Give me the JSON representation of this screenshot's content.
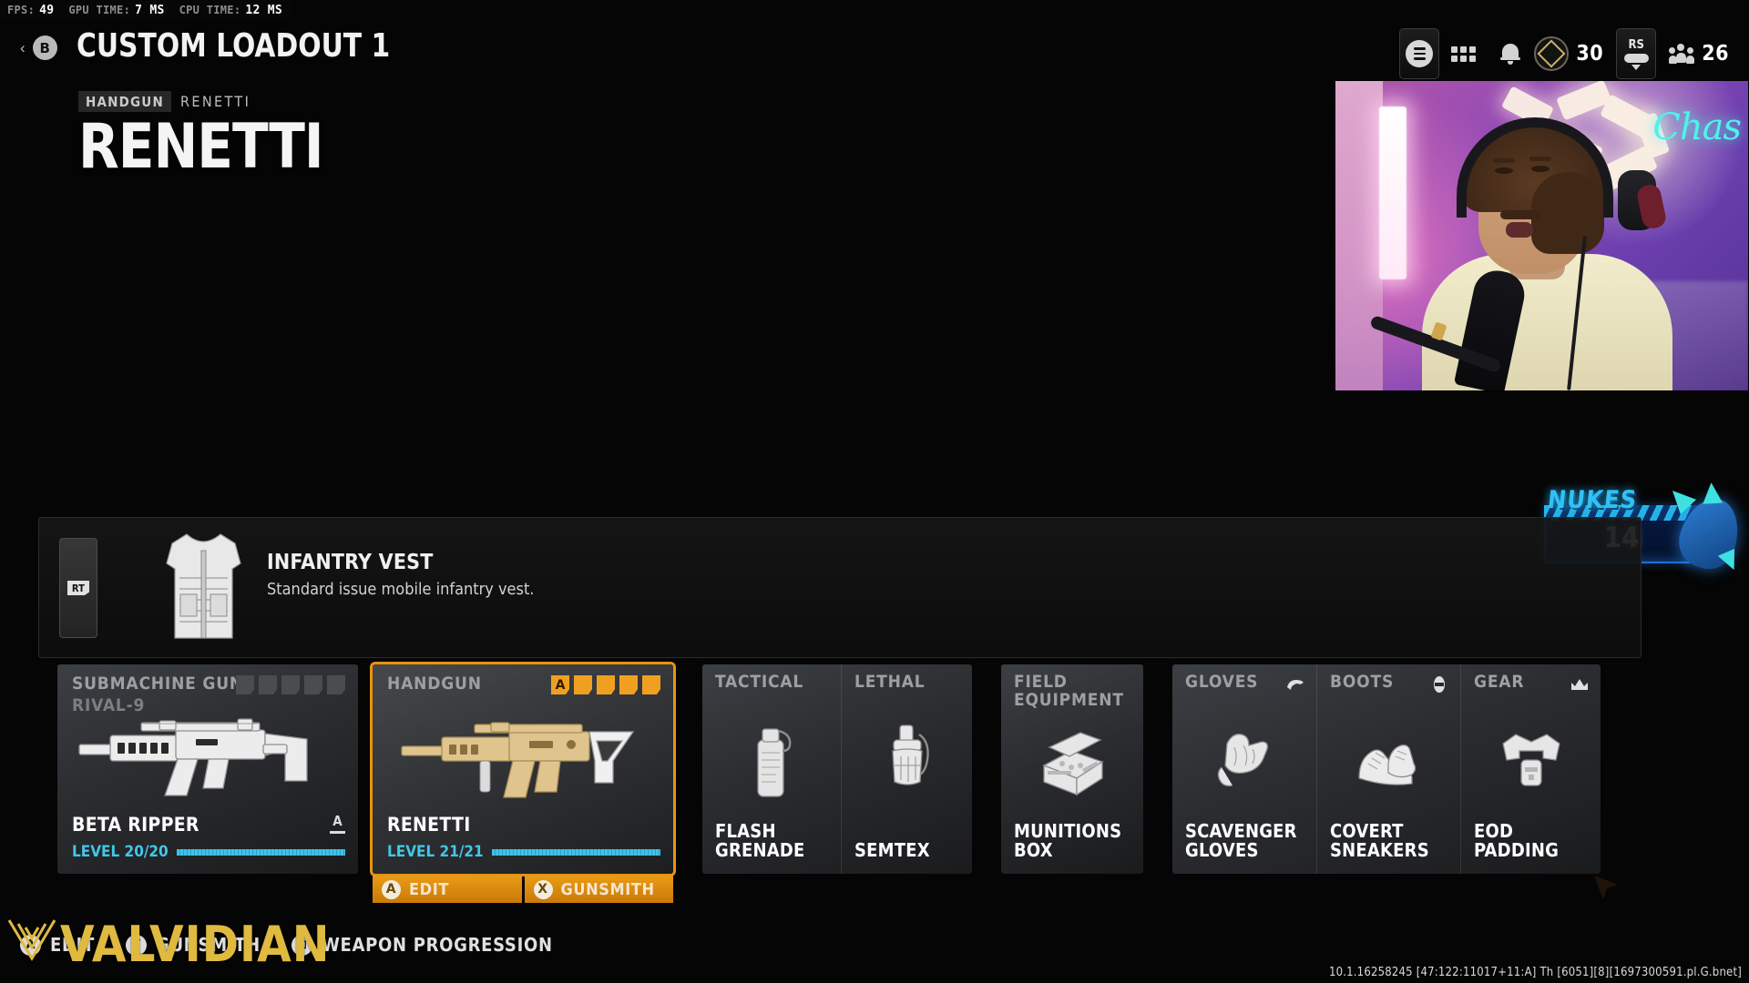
{
  "perf": {
    "stats": [
      {
        "key": "FPS:",
        "value": "49"
      },
      {
        "key": "GPU TIME:",
        "value": "7 MS"
      },
      {
        "key": "CPU TIME:",
        "value": "12 MS"
      }
    ]
  },
  "header": {
    "back_glyph": "B",
    "back_chevron": "‹",
    "title": "CUSTOM LOADOUT 1"
  },
  "hud": {
    "menu_icon": "hamburger-pill-icon",
    "apps_icon": "grid-icon",
    "bell_icon": "bell-icon",
    "rank_icon": "rank-badge-icon",
    "rank_value": "30",
    "rs_label": "RS",
    "party_icon": "party-icon",
    "party_value": "26"
  },
  "weapon": {
    "category_chip": "HANDGUN",
    "category_name": "RENETTI",
    "display_name": "RENETTI"
  },
  "nukes": {
    "title": "NUKES",
    "count": "14",
    "accent": "#2fc2f7"
  },
  "vest": {
    "trigger_glyph": "RT",
    "icon": "tactical-vest-icon",
    "title": "INFANTRY VEST",
    "description": "Standard issue mobile infantry vest."
  },
  "loadout": {
    "primary": {
      "category": "SUBMACHINE GUN",
      "subtitle": "RIVAL-9",
      "name": "BETA RIPPER",
      "level": "LEVEL 20/20",
      "level_percent": 100,
      "pips": [
        {
          "state": "off",
          "label": ""
        },
        {
          "state": "off",
          "label": ""
        },
        {
          "state": "off",
          "label": ""
        },
        {
          "state": "off",
          "label": ""
        },
        {
          "state": "off",
          "label": ""
        }
      ],
      "rank_glyph": "A",
      "selected": false
    },
    "secondary": {
      "category": "HANDGUN",
      "subtitle": "",
      "name": "RENETTI",
      "level": "LEVEL 21/21",
      "level_percent": 100,
      "pips": [
        {
          "state": "badge",
          "label": "A"
        },
        {
          "state": "on",
          "label": ""
        },
        {
          "state": "on",
          "label": ""
        },
        {
          "state": "on",
          "label": ""
        },
        {
          "state": "on",
          "label": ""
        }
      ],
      "selected": true,
      "actions": [
        {
          "glyph": "A",
          "label": "EDIT"
        },
        {
          "glyph": "X",
          "label": "GUNSMITH"
        }
      ]
    },
    "equipment": [
      {
        "category": "TACTICAL",
        "label": "FLASH GRENADE",
        "icon": "flash-grenade-icon",
        "perk_icon": ""
      },
      {
        "category": "LETHAL",
        "label": "SEMTEX",
        "icon": "semtex-grenade-icon",
        "perk_icon": ""
      }
    ],
    "field": [
      {
        "category": "FIELD EQUIPMENT",
        "label": "MUNITIONS BOX",
        "icon": "munitions-box-icon",
        "perk_icon": ""
      }
    ],
    "perks": [
      {
        "category": "GLOVES",
        "label": "SCAVENGER GLOVES",
        "icon": "gloves-icon",
        "perk_icon": "perk-glove-icon"
      },
      {
        "category": "BOOTS",
        "label": "COVERT SNEAKERS",
        "icon": "sneakers-icon",
        "perk_icon": "perk-boot-icon"
      },
      {
        "category": "GEAR",
        "label": "EOD PADDING",
        "icon": "eod-padding-icon",
        "perk_icon": "perk-gear-icon"
      }
    ]
  },
  "bottom_bar": {
    "items": [
      {
        "glyph": "A",
        "label": "EDIT"
      },
      {
        "glyph": "Y",
        "label": "GUNSMITH"
      },
      {
        "glyph": "⊡",
        "label": "WEAPON PROGRESSION"
      }
    ]
  },
  "watermark": {
    "text": "VALVIDIAN",
    "color": "#e0b93f"
  },
  "build_string": "10.1.16258245 [47:122:11017+11:A] Th [6051][8][1697300591.pl.G.bnet]"
}
